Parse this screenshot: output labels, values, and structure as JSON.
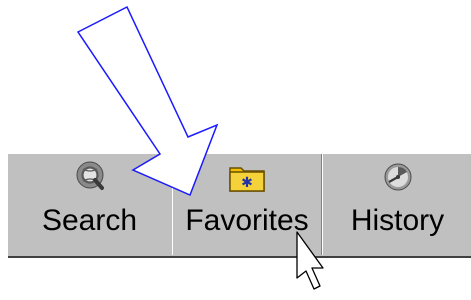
{
  "explorer_bar": {
    "tabs": [
      {
        "label": "Search",
        "icon": "search-globe-icon"
      },
      {
        "label": "Favorites",
        "icon": "favorites-folder-icon"
      },
      {
        "label": "History",
        "icon": "history-clock-icon"
      }
    ]
  },
  "annotation": {
    "arrow_color": "#1a1aff",
    "arrow_fill": "#ffffff"
  }
}
